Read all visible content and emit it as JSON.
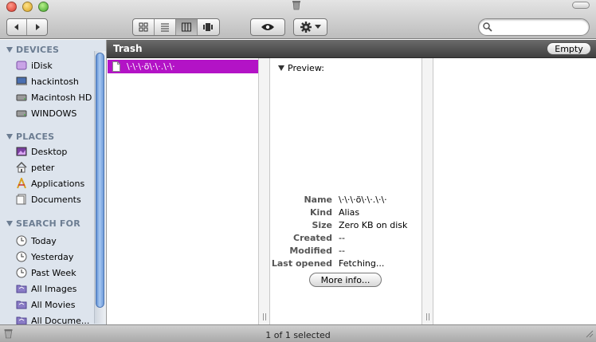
{
  "window": {
    "title_icon": "trash-icon"
  },
  "toolbar": {
    "back_icon": "triangle-left-icon",
    "forward_icon": "triangle-right-icon",
    "view_icons": [
      "icon-view-icon",
      "list-view-icon",
      "column-view-icon",
      "coverflow-view-icon"
    ],
    "active_view_index": 2,
    "quicklook_icon": "eye-icon",
    "action_icon": "gear-icon",
    "search_placeholder": "",
    "search_icon": "magnifier-icon"
  },
  "sidebar": {
    "sections": [
      {
        "label": "DEVICES",
        "items": [
          {
            "label": "iDisk",
            "icon": "idisk-icon"
          },
          {
            "label": "hackintosh",
            "icon": "computer-icon"
          },
          {
            "label": "Macintosh HD",
            "icon": "harddisk-icon"
          },
          {
            "label": "WINDOWS",
            "icon": "harddisk-icon"
          }
        ]
      },
      {
        "label": "PLACES",
        "items": [
          {
            "label": "Desktop",
            "icon": "desktop-icon"
          },
          {
            "label": "peter",
            "icon": "home-icon"
          },
          {
            "label": "Applications",
            "icon": "applications-icon"
          },
          {
            "label": "Documents",
            "icon": "documents-icon"
          }
        ]
      },
      {
        "label": "SEARCH FOR",
        "items": [
          {
            "label": "Today",
            "icon": "clock-icon"
          },
          {
            "label": "Yesterday",
            "icon": "clock-icon"
          },
          {
            "label": "Past Week",
            "icon": "clock-icon"
          },
          {
            "label": "All Images",
            "icon": "smart-folder-icon"
          },
          {
            "label": "All Movies",
            "icon": "smart-folder-icon"
          },
          {
            "label": "All Docume...",
            "icon": "smart-folder-icon"
          }
        ]
      }
    ]
  },
  "pathbar": {
    "title": "Trash",
    "empty_label": "Empty"
  },
  "columns": {
    "files": [
      {
        "name": "\\·\\·\\·õ\\·\\·.\\·\\·",
        "selected": true,
        "icon": "alias-file-icon"
      }
    ]
  },
  "preview": {
    "label": "Preview:",
    "info": [
      {
        "key": "Name",
        "value": "\\·\\·\\·õ\\·\\·.\\·\\·"
      },
      {
        "key": "Kind",
        "value": "Alias"
      },
      {
        "key": "Size",
        "value": "Zero KB on disk"
      },
      {
        "key": "Created",
        "value": "--"
      },
      {
        "key": "Modified",
        "value": "--"
      },
      {
        "key": "Last opened",
        "value": "Fetching..."
      }
    ],
    "more_info_label": "More info..."
  },
  "status": {
    "text": "1 of 1 selected"
  },
  "colors": {
    "selection": "#b313c6",
    "sidebar_bg": "#dde4ed",
    "sidebar_heading": "#6c7d92"
  }
}
